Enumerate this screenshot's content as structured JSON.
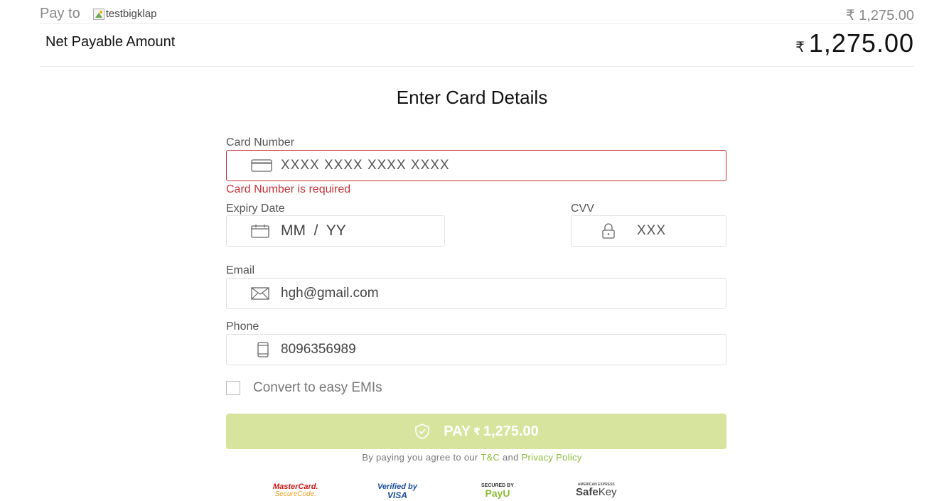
{
  "header": {
    "pay_to_label": "Pay to",
    "merchant_name": "testbigklap",
    "pay_amount": "₹ 1,275.00",
    "net_label": "Net Payable Amount",
    "net_currency": "₹",
    "net_value": "1,275.00"
  },
  "form": {
    "title": "Enter Card Details",
    "card_number": {
      "label": "Card Number",
      "placeholder": "XXXX XXXX XXXX XXXX",
      "icon": "credit-card-icon",
      "error": "Card Number is required"
    },
    "expiry": {
      "label": "Expiry Date",
      "placeholder": "MM  /  YY",
      "icon": "calendar-icon"
    },
    "cvv": {
      "label": "CVV",
      "placeholder": "XXX",
      "icon": "lock-icon"
    },
    "email": {
      "label": "Email",
      "value": "hgh@gmail.com",
      "icon": "mail-icon"
    },
    "phone": {
      "label": "Phone",
      "value": "8096356989",
      "icon": "phone-icon"
    },
    "emi_label": "Convert to easy EMIs",
    "emi_checked": false
  },
  "pay_button": {
    "label": "PAY",
    "currency": "₹",
    "amount": "1,275.00",
    "icon": "shield-check-icon"
  },
  "terms": {
    "prefix": "By paying you agree to our ",
    "tnc": "T&C",
    "middle": " and ",
    "privacy": "Privacy Policy"
  },
  "badges": {
    "mastercard_top": "MasterCard.",
    "mastercard_bottom": "SecureCode.",
    "visa_top": "Verified by",
    "visa_bottom": "VISA",
    "payu_top": "SECURED BY",
    "payu_bottom": "PayU",
    "amex_top": "AMERICAN EXPRESS",
    "amex_safe": "Safe",
    "amex_key": "Key"
  },
  "colors": {
    "error": "#c8323a",
    "pay_button_bg": "#d6e49e",
    "link": "#8dbb3a"
  }
}
